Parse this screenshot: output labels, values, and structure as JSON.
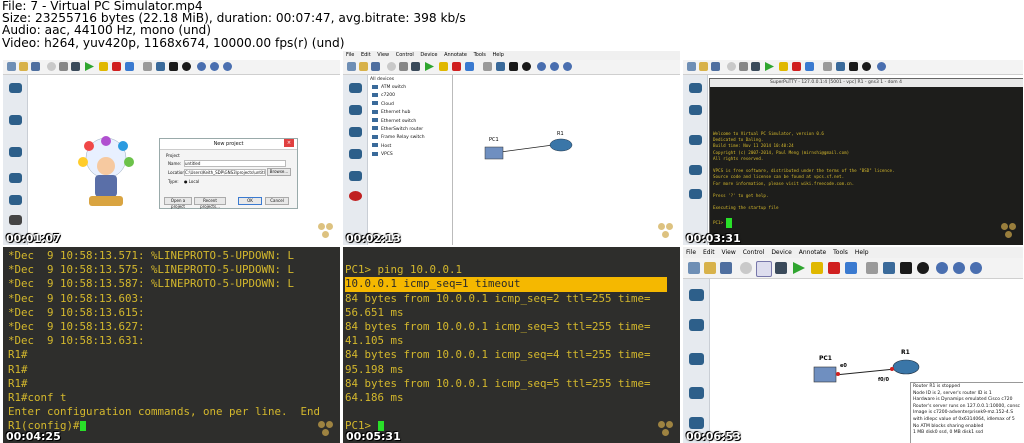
{
  "header": {
    "line1": "File: 7 - Virtual PC Simulator.mp4",
    "line2": "Size: 23255716 bytes (22.18 MiB), duration: 00:07:47, avg.bitrate: 398 kb/s",
    "line3": "Audio: aac, 44100 Hz, mono (und)",
    "line4": "Video: h264, yuv420p, 1168x674, 10000.00 fps(r) (und)"
  },
  "thumbnails": [
    {
      "timestamp": "00:01:07",
      "dialog": {
        "title": "New project",
        "project_label": "Project",
        "name_label": "Name:",
        "name_value": "untitled",
        "location_label": "Location:",
        "location_value": "C:\\Users\\Keith_SDP\\GNS3\\projects\\untitled",
        "browse_label": "Browse...",
        "type_label": "Type:",
        "type_value": "Local",
        "open_label": "Open a project",
        "recent_label": "Recent projects...",
        "ok_label": "OK",
        "cancel_label": "Cancel"
      }
    },
    {
      "timestamp": "00:02:13",
      "menu": [
        "File",
        "Edit",
        "View",
        "Control",
        "Device",
        "Annotate",
        "Tools",
        "Help"
      ],
      "device_list_title": "All devices",
      "devices": [
        "ATM switch",
        "c7200",
        "Cloud",
        "Ethernet hub",
        "Ethernet switch",
        "EtherSwitch router",
        "Frame Relay switch",
        "Host",
        "VPCS"
      ],
      "nodes": {
        "pc": "PC1",
        "router": "R1"
      }
    },
    {
      "timestamp": "00:03:31",
      "term_title": "SuperPuTTY - 127.0.0.1:4 [5001 - vpc] R1 - gns3 1 - dom 4",
      "lines": [
        "Welcome to Virtual PC Simulator, version 0.6",
        "Dedicated to Daling.",
        "Build time: Nov 11 2014 10:40:24",
        "Copyright (c) 2007-2014, Paul Meng (mirnshi@gmail.com)",
        "All rights reserved.",
        "",
        "VPCS is free software, distributed under the terms of the \"BSD\" licence.",
        "Source code and license can be found at vpcs.sf.net.",
        "For more information, please visit wiki.freecode.com.cn.",
        "",
        "Press '?' to get help.",
        "",
        "Executing the startup file",
        "",
        "PC1> "
      ]
    },
    {
      "timestamp": "00:04:25",
      "lines": [
        "*Dec  9 10:58:13.571: %LINEPROTO-5-UPDOWN: L",
        "*Dec  9 10:58:13.575: %LINEPROTO-5-UPDOWN: L",
        "*Dec  9 10:58:13.587: %LINEPROTO-5-UPDOWN: L",
        "*Dec  9 10:58:13.603:",
        "*Dec  9 10:58:13.615:",
        "*Dec  9 10:58:13.627:",
        "*Dec  9 10:58:13.631:",
        "R1#",
        "R1#",
        "R1#",
        "R1#conf t",
        "Enter configuration commands, one per line.  End",
        "R1(config)#"
      ]
    },
    {
      "timestamp": "00:05:31",
      "lines": [
        "",
        "PC1> ping 10.0.0.1",
        "10.0.0.1 icmp_seq=1 timeout",
        "84 bytes from 10.0.0.1 icmp_seq=2 ttl=255 time=",
        "56.651 ms",
        "84 bytes from 10.0.0.1 icmp_seq=3 ttl=255 time=",
        "41.105 ms",
        "84 bytes from 10.0.0.1 icmp_seq=4 ttl=255 time=",
        "95.198 ms",
        "84 bytes from 10.0.0.1 icmp_seq=5 ttl=255 time=",
        "64.186 ms",
        "",
        "PC1> "
      ]
    },
    {
      "timestamp": "00:06:53",
      "menu": [
        "File",
        "Edit",
        "View",
        "Control",
        "Device",
        "Annotate",
        "Tools",
        "Help"
      ],
      "nodes": {
        "pc": "PC1",
        "router": "R1",
        "pc_if": "e0",
        "router_if": "f0/0"
      },
      "tooltip": [
        "Router R1 is stopped",
        "Node ID is 2, server's router ID is 1",
        "Hardware is Dynamips emulated Cisco c720",
        "Router's server runs on 127.0.0.1:10000, consc",
        "Image is c7200-adventerprisek9-mz.152-4.S",
        "with idlepc value of 0x6314064, idlemax of 5",
        "No ATM blocks sharing enabled",
        "1 MB disk0 ssd, 0 MB disk1 ssd"
      ]
    }
  ],
  "colors": {
    "term_bg": "#2e2e2c",
    "term_text": "#d4b82c",
    "highlight": "#f5b800",
    "cursor": "#29e029",
    "timestamp": "#ffffff"
  }
}
